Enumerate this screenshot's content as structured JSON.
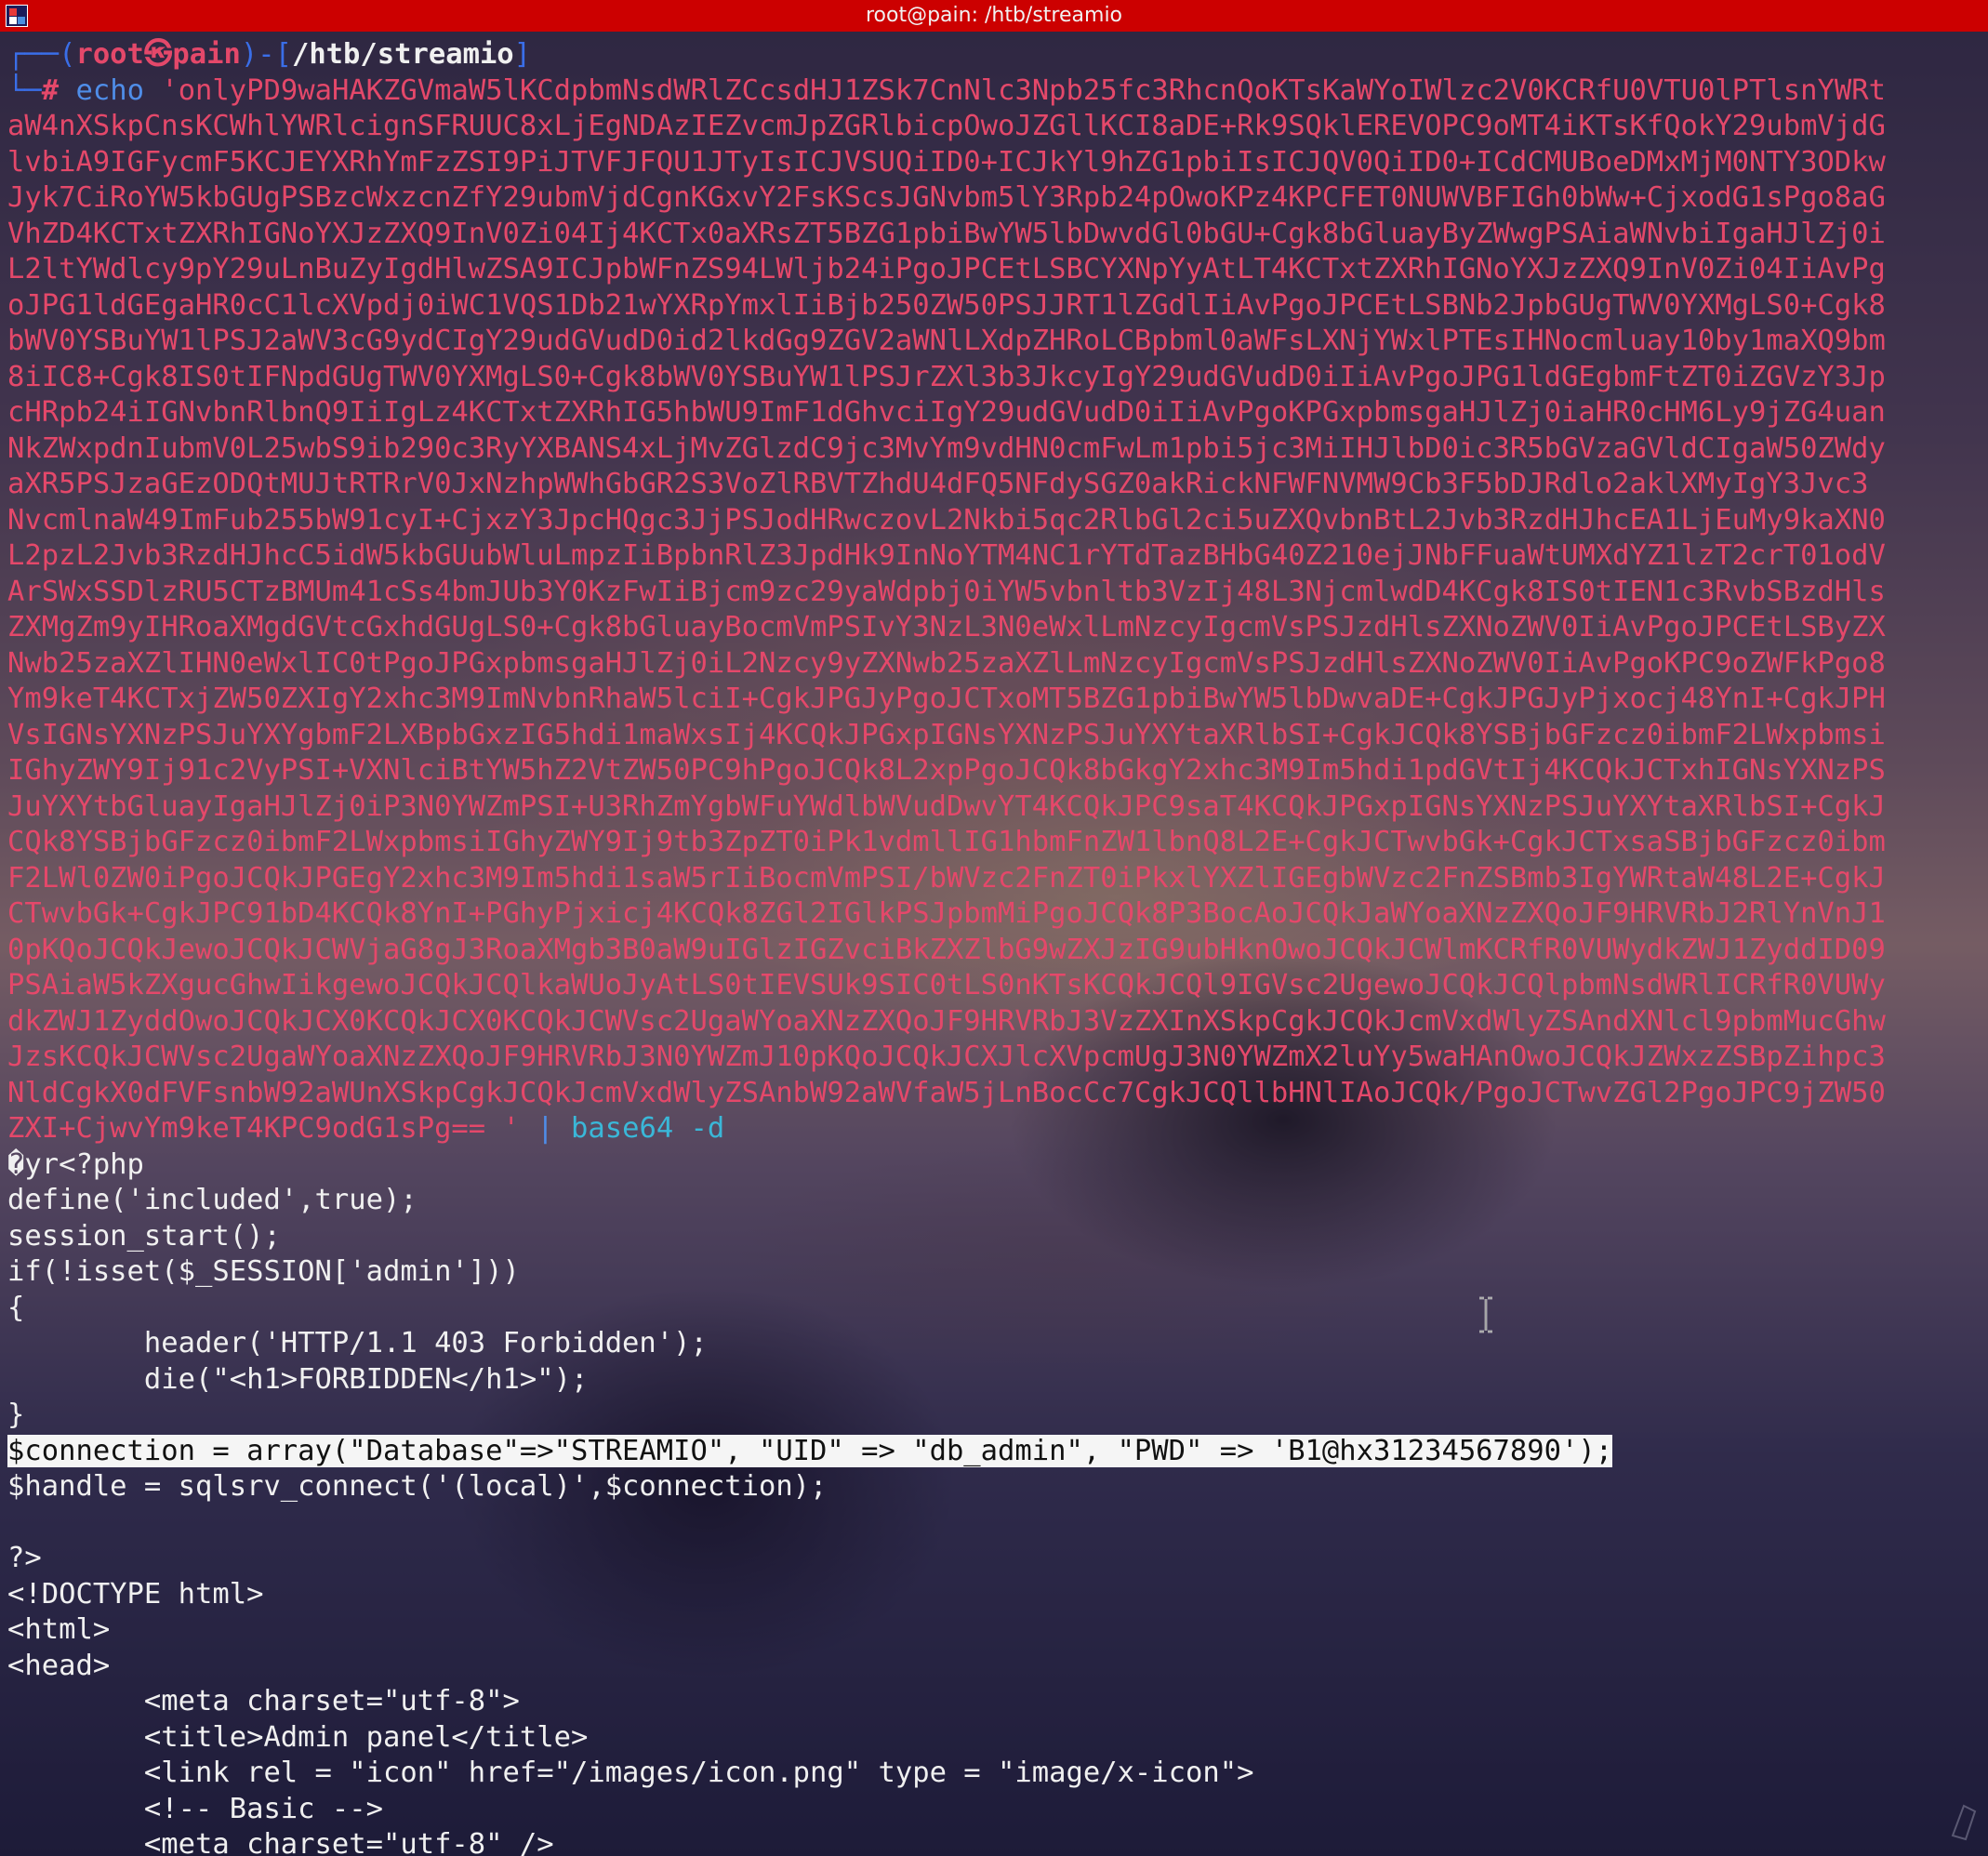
{
  "window": {
    "title": "root@pain: /htb/streamio"
  },
  "prompt": {
    "corner_top": "┌──(",
    "user": "root",
    "skull": "㉿",
    "host": "pain",
    "mid": ")-[",
    "path": "/htb/streamio",
    "end": "]",
    "corner_bottom": "└─",
    "hash": "#",
    "command": "echo",
    "quote_open": "'",
    "first_chunk": "onlyPD9waHAKZGVmaW5lKCdpbmNsdWRlZCcsdHJ1ZSk7CnNlc3Npb25fc3RhcnQoKTsKaWYoIWlzc2V0KCRfU0VTU0lPTlsnYWRt",
    "quote_close": "' ",
    "pipe": "|",
    "decoder": "base64 -d"
  },
  "base64_lines": [
    "aW4nXSkpCnsKCWhlYWRlcignSFRUUC8xLjEgNDAzIEZvcmJpZGRlbicpOwoJZGllKCI8aDE+Rk9SQklEREVOPC9oMT4iKTsKfQokY29ubmVjdG",
    "lvbiA9IGFycmF5KCJEYXRhYmFzZSI9PiJTVFJFQU1JTyIsICJVSUQiID0+ICJkYl9hZG1pbiIsICJQV0QiID0+ICdCMUBoeDMxMjM0NTY3ODkw",
    "Jyk7CiRoYW5kbGUgPSBzcWxzcnZfY29ubmVjdCgnKGxvY2FsKScsJGNvbm5lY3Rpb24pOwoKPz4KPCFET0NUWVBFIGh0bWw+CjxodG1sPgo8aG",
    "VhZD4KCTxtZXRhIGNoYXJzZXQ9InV0Zi04Ij4KCTx0aXRsZT5BZG1pbiBwYW5lbDwvdGl0bGU+Cgk8bGluayByZWwgPSAiaWNvbiIgaHJlZj0i",
    "L2ltYWdlcy9pY29uLnBuZyIgdHlwZSA9ICJpbWFnZS94LWljb24iPgoJPCEtLSBCYXNpYyAtLT4KCTxtZXRhIGNoYXJzZXQ9InV0Zi04IiAvPg",
    "oJPG1ldGEgaHR0cC1lcXVpdj0iWC1VQS1Db21wYXRpYmxlIiBjb250ZW50PSJJRT1lZGdlIiAvPgoJPCEtLSBNb2JpbGUgTWV0YXMgLS0+Cgk8",
    "bWV0YSBuYW1lPSJ2aWV3cG9ydCIgY29udGVudD0id2lkdGg9ZGV2aWNlLXdpZHRoLCBpbml0aWFsLXNjYWxlPTEsIHNocmluay10by1maXQ9bm",
    "8iIC8+Cgk8IS0tIFNpdGUgTWV0YXMgLS0+Cgk8bWV0YSBuYW1lPSJrZXl3b3JkcyIgY29udGVudD0iIiAvPgoJPG1ldGEgbmFtZT0iZGVzY3Jp",
    "cHRpb24iIGNvbnRlbnQ9IiIgLz4KCTxtZXRhIG5hbWU9ImF1dGhvciIgY29udGVudD0iIiAvPgoKPGxpbmsgaHJlZj0iaHR0cHM6Ly9jZG4uan",
    "NkZWxpdnIubmV0L25wbS9ib290c3RyYXBANS4xLjMvZGlzdC9jc3MvYm9vdHN0cmFwLm1pbi5jc3MiIHJlbD0ic3R5bGVzaGVldCIgaW50ZWdy",
    "aXR5PSJzaGEzODQtMUJtRTRrV0JxNzhpWWhGbGR2S3VoZlRBVTZhdU4dFQ5NFdySGZ0akRickNFWFNVMW9Cb3F5bDJRdlo2aklXMyIgY3Jvc3",
    "NvcmlnaW49ImFub255bW91cyI+CjxzY3JpcHQgc3JjPSJodHRwczovL2Nkbi5qc2RlbGl2ci5uZXQvbnBtL2Jvb3RzdHJhcEA1LjEuMy9kaXN0",
    "L2pzL2Jvb3RzdHJhcC5idW5kbGUubWluLmpzIiBpbnRlZ3JpdHk9InNoYTM4NC1rYTdTazBHbG40Z210ejJNbFFuaWtUMXdYZ1lzT2crT01odV",
    "ArSWxSSDlzRU5CTzBMUm41cSs4bmJUb3Y0KzFwIiBjcm9zc29yaWdpbj0iYW5vbnltb3VzIj48L3NjcmlwdD4KCgk8IS0tIEN1c3RvbSBzdHls",
    "ZXMgZm9yIHRoaXMgdGVtcGxhdGUgLS0+Cgk8bGluayBocmVmPSIvY3NzL3N0eWxlLmNzcyIgcmVsPSJzdHlsZXNoZWV0IiAvPgoJPCEtLSByZX",
    "Nwb25zaXZlIHN0eWxlIC0tPgoJPGxpbmsgaHJlZj0iL2Nzcy9yZXNwb25zaXZlLmNzcyIgcmVsPSJzdHlsZXNoZWV0IiAvPgoKPC9oZWFkPgo8",
    "Ym9keT4KCTxjZW50ZXIgY2xhc3M9ImNvbnRhaW5lciI+CgkJPGJyPgoJCTxoMT5BZG1pbiBwYW5lbDwvaDE+CgkJPGJyPjxocj48YnI+CgkJPH",
    "VsIGNsYXNzPSJuYXYgbmF2LXBpbGxzIG5hdi1maWxsIj4KCQkJPGxpIGNsYXNzPSJuYXYtaXRlbSI+CgkJCQk8YSBjbGFzcz0ibmF2LWxpbmsi",
    "IGhyZWY9Ij91c2VyPSI+VXNlciBtYW5hZ2VtZW50PC9hPgoJCQk8L2xpPgoJCQk8bGkgY2xhc3M9Im5hdi1pdGVtIj4KCQkJCTxhIGNsYXNzPS",
    "JuYXYtbGluayIgaHJlZj0iP3N0YWZmPSI+U3RhZmYgbWFuYWdlbWVudDwvYT4KCQkJPC9saT4KCQkJPGxpIGNsYXNzPSJuYXYtaXRlbSI+CgkJ",
    "CQk8YSBjbGFzcz0ibmF2LWxpbmsiIGhyZWY9Ij9tb3ZpZT0iPk1vdmllIG1hbmFnZW1lbnQ8L2E+CgkJCTwvbGk+CgkJCTxsaSBjbGFzcz0ibm",
    "F2LWl0ZW0iPgoJCQkJPGEgY2xhc3M9Im5hdi1saW5rIiBocmVmPSI/bWVzc2FnZT0iPkxlYXZlIGEgbWVzc2FnZSBmb3IgYWRtaW48L2E+CgkJ",
    "CTwvbGk+CgkJPC91bD4KCQk8YnI+PGhyPjxicj4KCQk8ZGl2IGlkPSJpbmMiPgoJCQk8P3BocAoJCQkJaWYoaXNzZXQoJF9HRVRbJ2RlYnVnJ1",
    "0pKQoJCQkJewoJCQkJCWVjaG8gJ3RoaXMgb3B0aW9uIGlzIGZvciBkZXZlbG9wZXJzIG9ubHknOwoJCQkJCWlmKCRfR0VUWydkZWJ1ZyddID09",
    "PSAiaW5kZXgucGhwIikgewoJCQkJCQlkaWUoJyAtLS0tIEVSUk9SIC0tLS0nKTsKCQkJCQl9IGVsc2UgewoJCQkJCQlpbmNsdWRlICRfR0VUWy",
    "dkZWJ1ZyddOwoJCQkJCX0KCQkJCX0KCQkJCWVsc2UgaWYoaXNzZXQoJF9HRVRbJ3VzZXInXSkpCgkJCQkJcmVxdWlyZSAndXNlcl9pbmMucGhw",
    "JzsKCQkJCWVsc2UgaWYoaXNzZXQoJF9HRVRbJ3N0YWZmJ10pKQoJCQkJCXJlcXVpcmUgJ3N0YWZmX2luYy5waHAnOwoJCQkJZWxzZSBpZihpc3",
    "NldCgkX0dFVFsnbW92aWUnXSkpCgkJCQkJcmVxdWlyZSAnbW92aWVfaW5jLnBocCc7CgkJCQllbHNlIAoJCQk/PgoJCTwvZGl2PgoJPC9jZW50",
    "ZXI+CjwvYm9keT4KPC9odG1sPg== "
  ],
  "output_lines": [
    "�yr<?php",
    "define('included',true);",
    "session_start();",
    "if(!isset($_SESSION['admin']))",
    "{",
    "        header('HTTP/1.1 403 Forbidden');",
    "        die(\"<h1>FORBIDDEN</h1>\");",
    "}",
    "$connection = array(\"Database\"=>\"STREAMIO\", \"UID\" => \"db_admin\", \"PWD\" => 'B1@hx31234567890');",
    "$handle = sqlsrv_connect('(local)',$connection);",
    "",
    "?>",
    "<!DOCTYPE html>",
    "<html>",
    "<head>",
    "        <meta charset=\"utf-8\">",
    "        <title>Admin panel</title>",
    "        <link rel = \"icon\" href=\"/images/icon.png\" type = \"image/x-icon\">",
    "        <!-- Basic -->",
    "        <meta charset=\"utf-8\" />"
  ],
  "highlighted_line_index": 8,
  "colors": {
    "titlebar": "#cc0000",
    "prompt_red": "#e4486a",
    "prompt_blue": "#3a6ee8",
    "command_blue": "#4f8de8",
    "pipe_cyan": "#3ab7d8",
    "text": "#f0f0f0"
  },
  "icons": {
    "app": "terminal-app-icon",
    "cursor": "text-cursor-icon",
    "corner": "scroll-widget-icon"
  }
}
